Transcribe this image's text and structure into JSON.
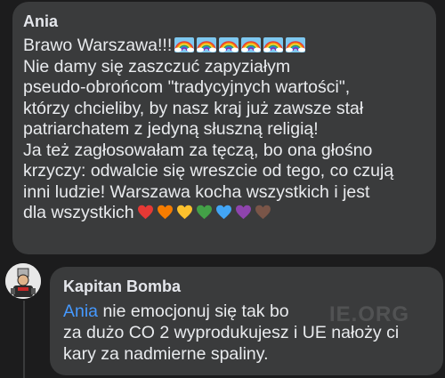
{
  "comment1": {
    "author": "Ania",
    "lines": [
      "Brawo Warszawa!!!",
      "Nie damy się zaszczuć zapyziałym",
      "pseudo-obrońcom \"tradycyjnych wartości\",",
      "którzy chcieliby, by nasz kraj już zawsze stał",
      "patriarchatem z jedyną słuszną religią!",
      "Ja też zagłosowałam za tęczą, bo ona głośno",
      "krzyczy: odwalcie się wreszcie od tego, co czują",
      "inni ludzie! Warszawa kocha wszystkich i jest",
      "dla wszystkich"
    ],
    "emoji_rainbows": [
      "rainbow-icon",
      "rainbow-icon",
      "rainbow-icon",
      "rainbow-icon",
      "rainbow-icon",
      "rainbow-icon"
    ],
    "hearts": [
      {
        "name": "red-heart-icon",
        "color": "#e53935"
      },
      {
        "name": "orange-heart-icon",
        "color": "#f57c00"
      },
      {
        "name": "yellow-heart-icon",
        "color": "#fbc02d"
      },
      {
        "name": "green-heart-icon",
        "color": "#43a047"
      },
      {
        "name": "blue-heart-icon",
        "color": "#42a5f5"
      },
      {
        "name": "purple-heart-icon",
        "color": "#8e44ad"
      },
      {
        "name": "brown-heart-icon",
        "color": "#795548"
      }
    ]
  },
  "comment2": {
    "author": "Kapitan Bomba",
    "mention": "Ania",
    "line1_rest": " nie emocjonuj się tak bo",
    "lines": [
      "za dużo CO 2 wyprodukujesz i UE nałoży ci",
      "kary za nadmierne spaliny."
    ]
  },
  "watermark": "IE.ORG",
  "colors": {
    "background": "#1c1c1d",
    "bubble": "#3a3b3c",
    "text": "#e4e6eb",
    "mention": "#4599ff"
  }
}
